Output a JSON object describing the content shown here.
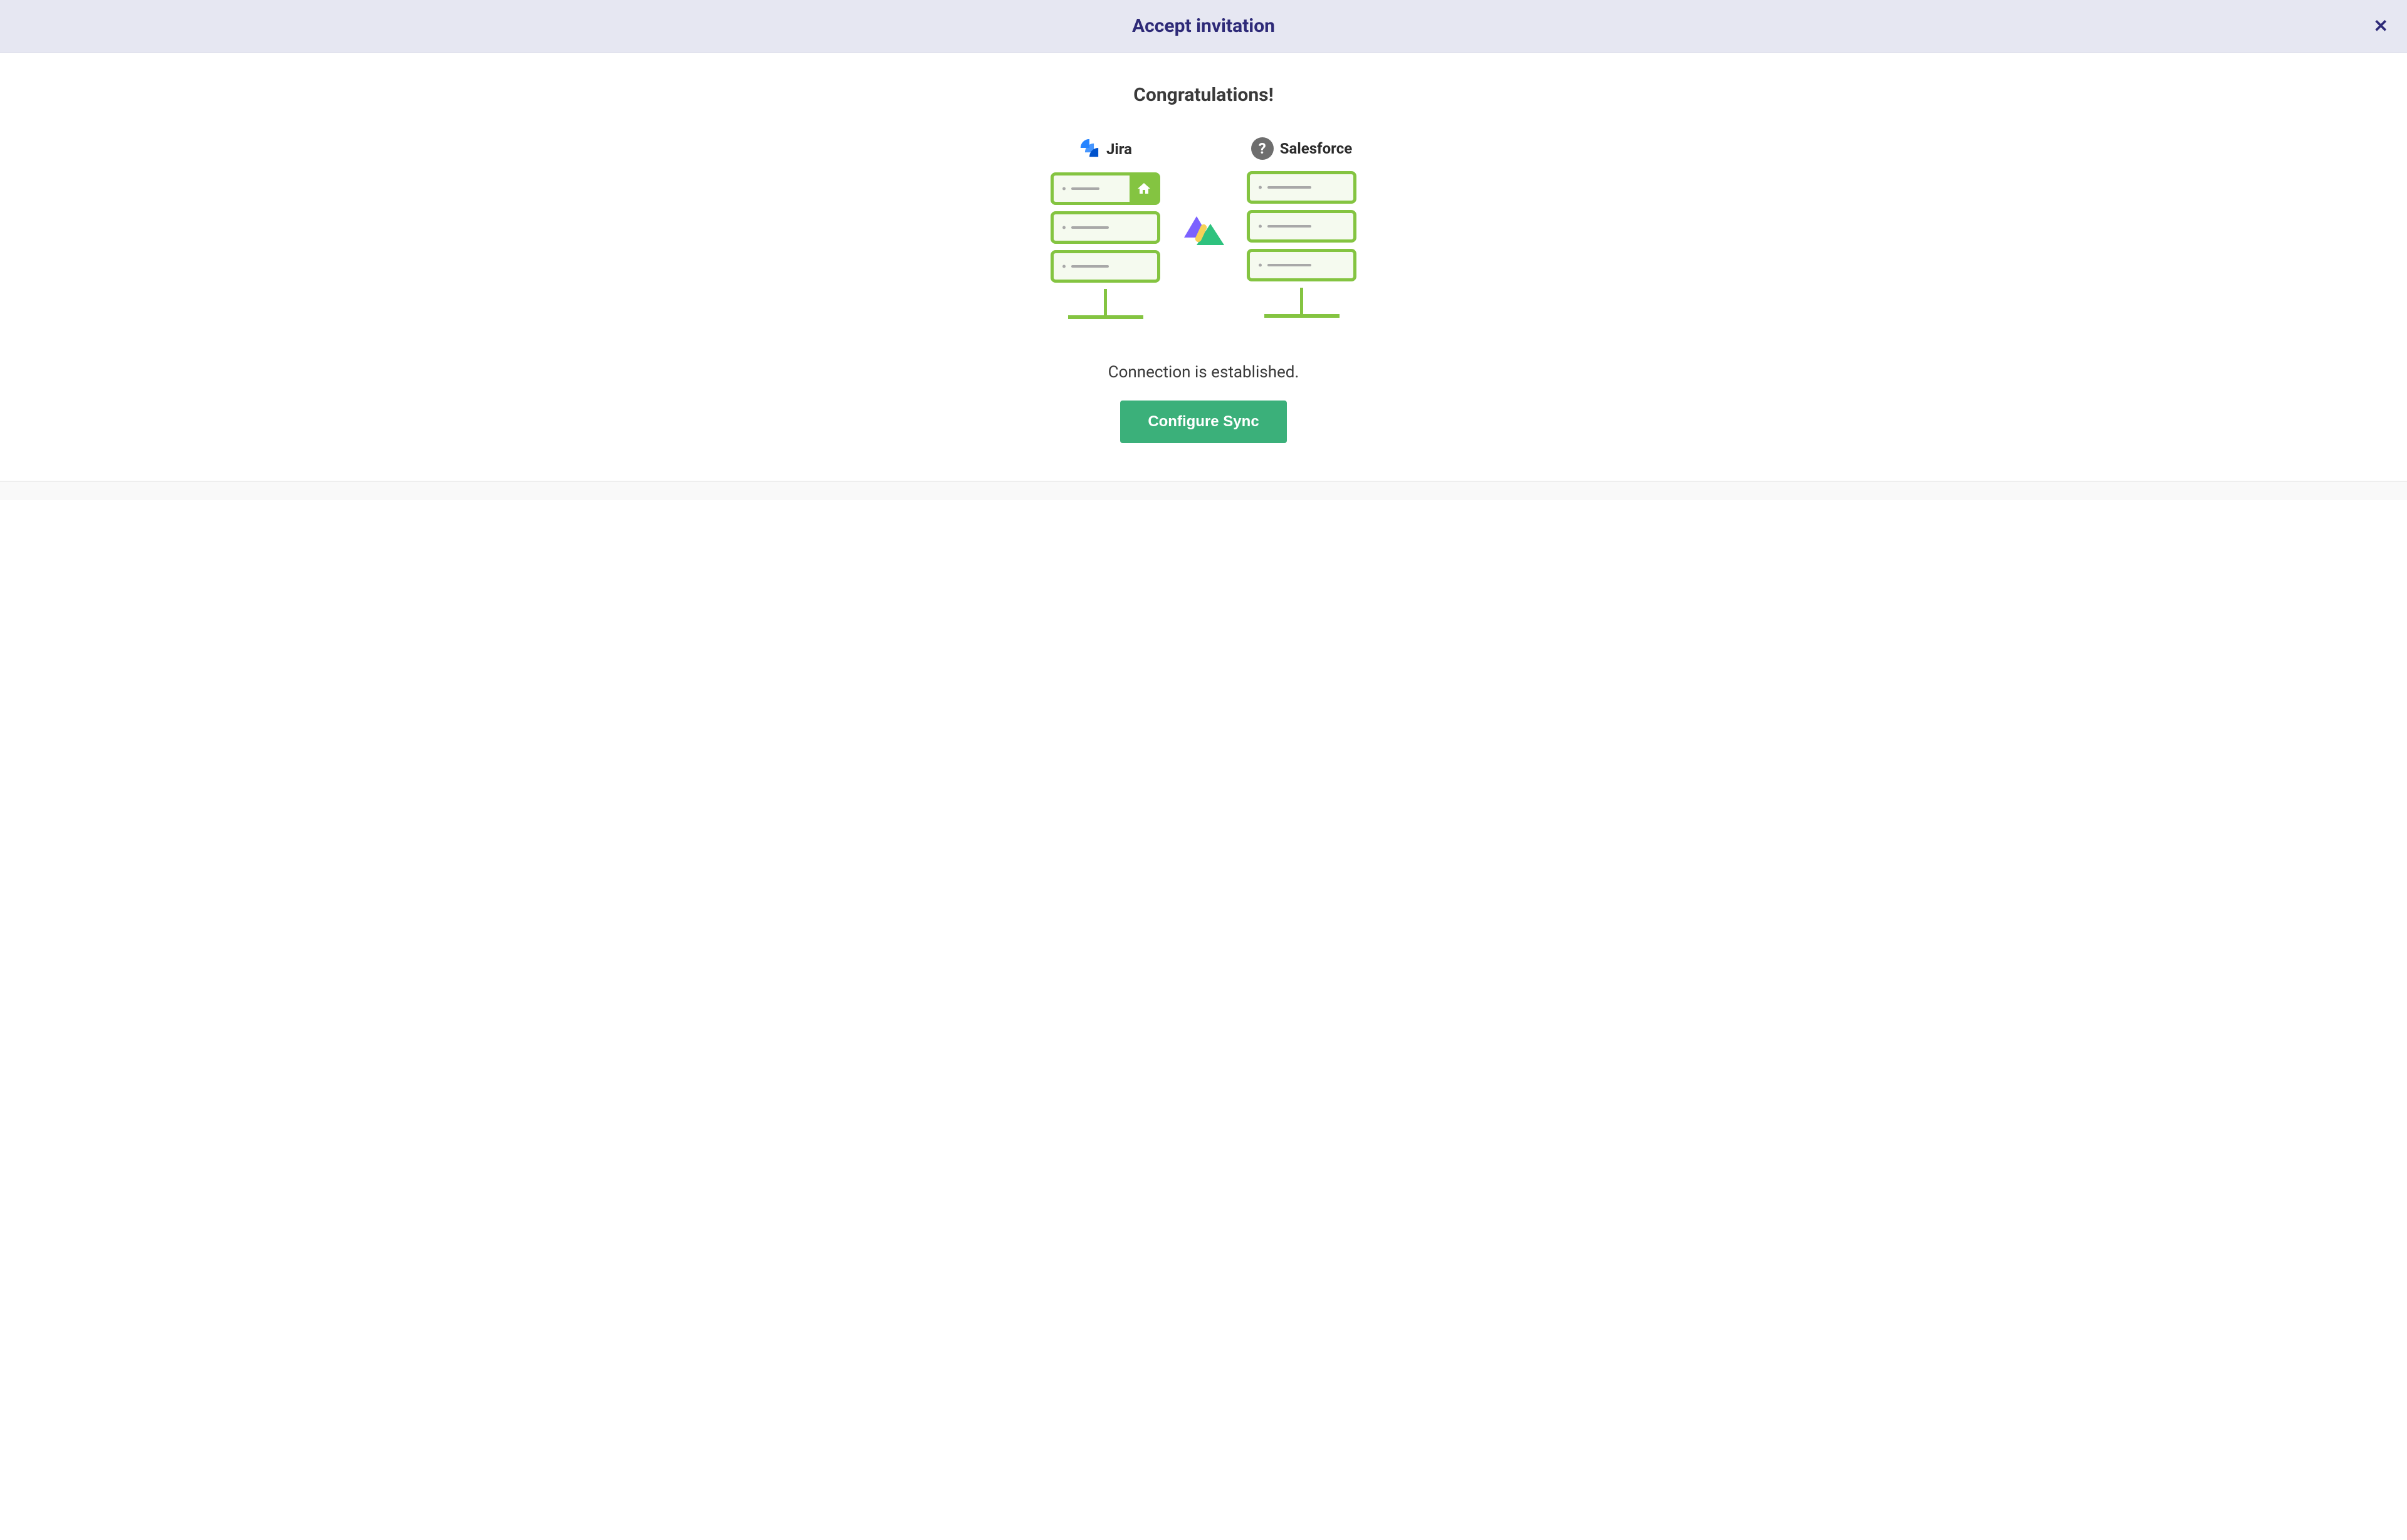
{
  "header": {
    "title": "Accept invitation"
  },
  "body": {
    "congrats": "Congratulations!",
    "left_system": "Jira",
    "right_system": "Salesforce",
    "status": "Connection is established.",
    "configure_button": "Configure Sync"
  }
}
